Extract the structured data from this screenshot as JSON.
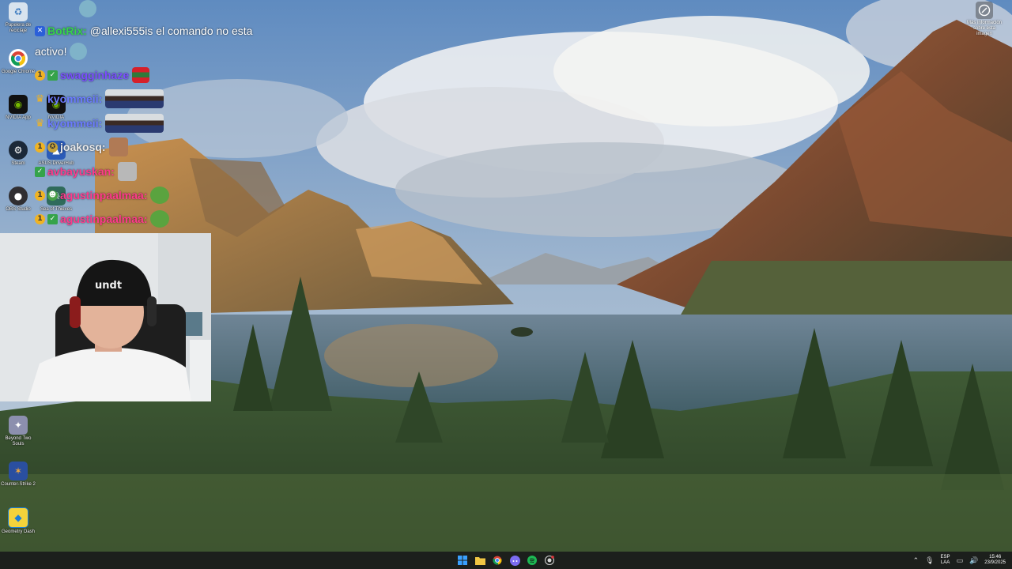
{
  "desktop_icons": [
    {
      "label": "Papelera de reciclaje",
      "icon": "recycle-bin-icon"
    },
    {
      "label": "Google Chrome",
      "icon": "chrome-icon"
    },
    {
      "label": "NVIDIA App",
      "icon": "nvidia-icon"
    },
    {
      "label": "Steam",
      "icon": "steam-icon"
    },
    {
      "label": "OBS Studio",
      "icon": "obs-icon"
    },
    {
      "label": "Beyond Two Souls",
      "icon": "beyond-two-souls-icon"
    },
    {
      "label": "Counter-Strike 2",
      "icon": "counter-strike-icon"
    },
    {
      "label": "Geometry Dash",
      "icon": "geometry-dash-icon"
    }
  ],
  "desktop_icons_col2": [
    {
      "label": "NVIDIA",
      "icon": "nvidia-icon"
    },
    {
      "label": "ASUS DriverHub",
      "icon": "asus-icon"
    },
    {
      "label": "Sea of Thieves",
      "icon": "sea-of-thieves-icon"
    }
  ],
  "chat": {
    "lines": [
      {
        "username": "BotRix:",
        "color": "#37d44a",
        "message": "@allexi555is el comando no esta",
        "badge": "bot"
      },
      {
        "username": "",
        "color": "#ffffff",
        "message": "activo!",
        "badge": ""
      },
      {
        "username": "swagginhaze",
        "color": "#7b4dff",
        "message": "",
        "badge": "1"
      },
      {
        "username": "kyommeii:",
        "color": "#6b7bff",
        "message": "",
        "badge": "crown"
      },
      {
        "username": "kyommeii:",
        "color": "#6b7bff",
        "message": "",
        "badge": "crown"
      },
      {
        "username": "joakosq:",
        "color": "#e8e8e8",
        "message": "",
        "badge": "1"
      },
      {
        "username": "avbayuskan:",
        "color": "#ff3a8c",
        "message": "",
        "badge": ""
      },
      {
        "username": "agustinpaalmaa:",
        "color": "#ff3a8c",
        "message": "",
        "badge": "1"
      },
      {
        "username": "agustinpaalmaa:",
        "color": "#ff3a8c",
        "message": "",
        "badge": "1"
      }
    ]
  },
  "top_right_icon": {
    "label": "Más información sobre esta imagen",
    "icon": "info-circle-icon"
  },
  "taskbar": {
    "apps": [
      {
        "name": "start-button",
        "icon": "windows-icon",
        "color": "#3aa0ff"
      },
      {
        "name": "file-explorer-button",
        "icon": "folder-icon",
        "color": "#f2c744"
      },
      {
        "name": "chrome-button",
        "icon": "chrome-icon",
        "color": "#e8453c"
      },
      {
        "name": "discord-button",
        "icon": "discord-icon",
        "color": "#7b6cf0"
      },
      {
        "name": "spotify-button",
        "icon": "spotify-icon",
        "color": "#1db954"
      },
      {
        "name": "obs-button",
        "icon": "record-icon",
        "color": "#d8d8d8"
      }
    ],
    "language_line1": "ESP",
    "language_line2": "LAA",
    "time": "15:46",
    "date": "23/9/2025"
  }
}
